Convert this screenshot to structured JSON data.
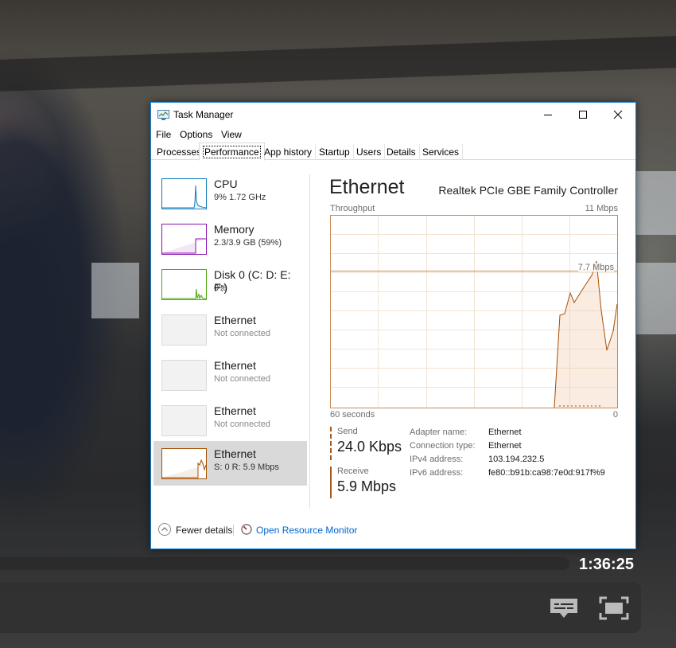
{
  "video": {
    "timestamp": "1:36:25"
  },
  "window": {
    "title": "Task Manager",
    "icon": "task-manager-icon"
  },
  "menu": [
    "File",
    "Options",
    "View"
  ],
  "tabs": [
    "Processes",
    "Performance",
    "App history",
    "Startup",
    "Users",
    "Details",
    "Services"
  ],
  "active_tab": "Performance",
  "sidebar": {
    "items": [
      {
        "title": "CPU",
        "subtitle": "9%  1.72 GHz",
        "color": "#117dbb"
      },
      {
        "title": "Memory",
        "subtitle": "2.3/3.9 GB (59%)",
        "color": "#8b12ae"
      },
      {
        "title": "Disk 0 (C: D: E: F:)",
        "subtitle": "0%",
        "color": "#4da60c"
      },
      {
        "title": "Ethernet",
        "subtitle": "Not connected",
        "color": "#a7a7a7"
      },
      {
        "title": "Ethernet",
        "subtitle": "Not connected",
        "color": "#a7a7a7"
      },
      {
        "title": "Ethernet",
        "subtitle": "Not connected",
        "color": "#a7a7a7"
      },
      {
        "title": "Ethernet",
        "subtitle": "S: 0  R: 5.9 Mbps",
        "color": "#a74f01"
      }
    ]
  },
  "detail": {
    "title": "Ethernet",
    "adapter_name": "Realtek PCIe GBE Family Controller",
    "graph_label": "Throughput",
    "graph_max": "11 Mbps",
    "graph_marker": "7.7 Mbps",
    "x_left": "60 seconds",
    "x_right": "0",
    "send_label": "Send",
    "send_value": "24.0 Kbps",
    "receive_label": "Receive",
    "receive_value": "5.9 Mbps",
    "info": [
      {
        "key": "Adapter name:",
        "value": "Ethernet"
      },
      {
        "key": "Connection type:",
        "value": "Ethernet"
      },
      {
        "key": "IPv4 address:",
        "value": "103.194.232.5"
      },
      {
        "key": "IPv6 address:",
        "value": "fe80::b91b:ca98:7e0d:917f%9"
      }
    ]
  },
  "footer": {
    "fewer_details": "Fewer details",
    "open_resource_monitor": "Open Resource Monitor"
  },
  "colors": {
    "accent_border": "#1883d7",
    "network_line": "#a74f01",
    "link": "#0066cc"
  }
}
